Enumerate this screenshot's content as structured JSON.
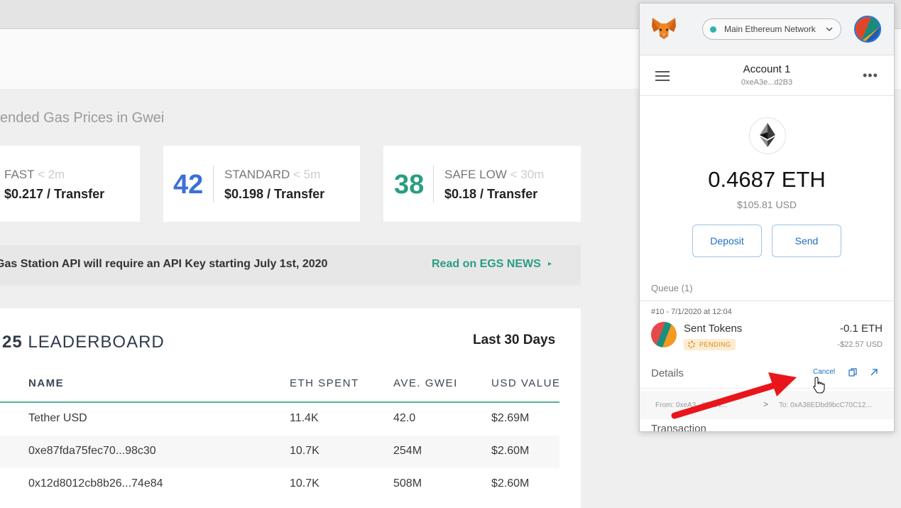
{
  "gas": {
    "section_title": "ended Gas Prices in Gwei",
    "cards": [
      {
        "number": "",
        "label": "FAST",
        "time": "< 2m",
        "price": "$0.217 / Transfer",
        "color": "#3a6fd8"
      },
      {
        "number": "42",
        "label": "STANDARD",
        "time": "< 5m",
        "price": "$0.198 / Transfer",
        "color": "#3a6fd8"
      },
      {
        "number": "38",
        "label": "SAFE LOW",
        "time": "< 30m",
        "price": "$0.18 / Transfer",
        "color": "#2a9d84"
      }
    ]
  },
  "news": {
    "text": "Gas Station API will require an API Key starting July 1st, 2020",
    "link": "Read on EGS NEWS",
    "arrow": "▸"
  },
  "leaderboard": {
    "title_number": "25",
    "title_word": "LEADERBOARD",
    "period": "Last 30 Days",
    "columns": [
      "NAME",
      "ETH SPENT",
      "AVE. GWEI",
      "USD VALUE"
    ],
    "rows": [
      [
        "Tether USD",
        "11.4K",
        "42.0",
        "$2.69M"
      ],
      [
        "0xe87fda75fec70...98c30",
        "10.7K",
        "254M",
        "$2.60M"
      ],
      [
        "0x12d8012cb8b26...74e84",
        "10.7K",
        "508M",
        "$2.60M"
      ]
    ]
  },
  "metamask": {
    "network": "Main Ethereum Network",
    "account_name": "Account 1",
    "account_address": "0xeA3e...d2B3",
    "more": "•••",
    "balance": "0.4687 ETH",
    "balance_usd": "$105.81 USD",
    "deposit_label": "Deposit",
    "send_label": "Send",
    "queue_label": "Queue (1)",
    "tx": {
      "date": "#10 - 7/1/2020 at 12:04",
      "title": "Sent Tokens",
      "status": "PENDING",
      "amount": "-0.1 ETH",
      "amount_usd": "-$22.57 USD"
    },
    "details_label": "Details",
    "cancel_label": "Cancel",
    "from": "From: 0xeA3...07114...",
    "to": "To: 0xA38EDbd9bcC70C12...",
    "transaction_label": "Transaction",
    "accent_color": "#1f6fc6"
  },
  "annotation": {
    "arrow_color": "#e8161b"
  }
}
